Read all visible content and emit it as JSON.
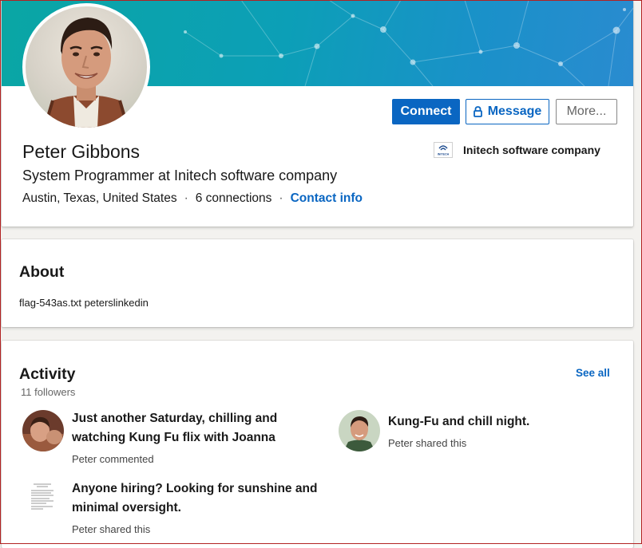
{
  "profile": {
    "name": "Peter Gibbons",
    "headline": "System Programmer at Initech software company",
    "location": "Austin, Texas, United States",
    "separator": "·",
    "connections": "6 connections",
    "contact_info": "Contact info",
    "company": "Initech software company",
    "company_logo_text": "INITECH"
  },
  "actions": {
    "connect": "Connect",
    "message": "Message",
    "more": "More..."
  },
  "about": {
    "title": "About",
    "text": "flag-543as.txt peterslinkedin"
  },
  "activity": {
    "title": "Activity",
    "followers": "11 followers",
    "see_all": "See all",
    "items": [
      {
        "line1": "Just another Saturday, chilling and",
        "line2": "watching Kung Fu flix with Joanna",
        "subtitle": "Peter commented"
      },
      {
        "line1": "Kung-Fu and chill night.",
        "subtitle": "Peter shared this"
      },
      {
        "line1": "Anyone hiring? Looking for sunshine and",
        "line2": "minimal oversight.",
        "subtitle": "Peter shared this"
      }
    ]
  },
  "colors": {
    "primary": "#0a66c2",
    "banner": "#0c9fb7",
    "text": "#191919",
    "muted": "#666666"
  },
  "icons": [
    "lock-icon",
    "initech-logo",
    "avatar",
    "document-thumbnail"
  ]
}
